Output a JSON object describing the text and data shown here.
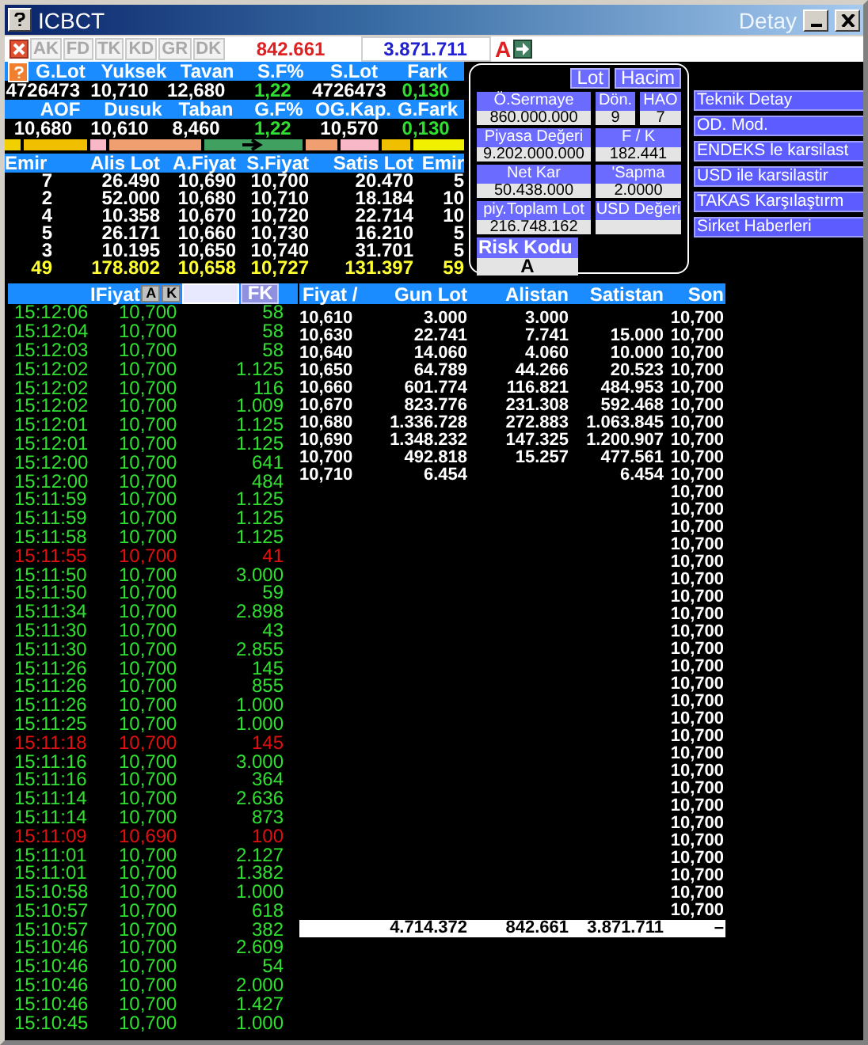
{
  "window": {
    "title": "ICBCT",
    "subtitle": "Detay"
  },
  "toolbar": {
    "tabs": [
      {
        "label": "AK",
        "disabled": true
      },
      {
        "label": "FD",
        "disabled": true
      },
      {
        "label": "TK",
        "disabled": true
      },
      {
        "label": "KD",
        "disabled": true
      },
      {
        "label": "GR",
        "disabled": true
      },
      {
        "label": "DK",
        "disabled": true
      }
    ],
    "alistan_total": "842.661",
    "satistan_total": "3.871.711",
    "mode": "A"
  },
  "stats": [
    {
      "cells": [
        {
          "label": "G.Lot",
          "value": "4726473",
          "up": false
        },
        {
          "label": "Yuksek",
          "value": "10,710",
          "up": false
        },
        {
          "label": "Tavan",
          "value": "12,680",
          "up": false
        },
        {
          "label": "S.F%",
          "value": "1,22",
          "up": true
        },
        {
          "label": "S.Lot",
          "value": "4726473",
          "up": false
        },
        {
          "label": "Fark",
          "value": "0,130",
          "up": true
        }
      ]
    },
    {
      "cells": [
        {
          "label": "AOF",
          "value": "10,680",
          "up": false
        },
        {
          "label": "Dusuk",
          "value": "10,610",
          "up": false
        },
        {
          "label": "Taban",
          "value": "8,460",
          "up": false
        },
        {
          "label": "G.F%",
          "value": "1,22",
          "up": true
        },
        {
          "label": "OG.Kap.",
          "value": "10,570",
          "up": false
        },
        {
          "label": "G.Fark",
          "value": "0,130",
          "up": true
        }
      ]
    }
  ],
  "order_book": {
    "columns": [
      "Emir",
      "Alis Lot",
      "A.Fiyat",
      "S.Fiyat",
      "Satis Lot",
      "Emir"
    ],
    "rows": [
      [
        "7",
        "26.490",
        "10,690",
        "10,700",
        "20.470",
        "5"
      ],
      [
        "2",
        "52.000",
        "10,680",
        "10,710",
        "18.184",
        "10"
      ],
      [
        "4",
        "10.358",
        "10,670",
        "10,720",
        "22.714",
        "10"
      ],
      [
        "5",
        "26.171",
        "10,660",
        "10,730",
        "16.210",
        "5"
      ],
      [
        "3",
        "10.195",
        "10,650",
        "10,740",
        "31.701",
        "5"
      ]
    ],
    "total": [
      "49",
      "178.802",
      "10,658",
      "10,727",
      "131.397",
      "59"
    ]
  },
  "info_panel": {
    "toggles": [
      "Lot",
      "Hacim"
    ],
    "field_rows": [
      [
        {
          "label": "Ö.Sermaye",
          "value": "860.000.000"
        },
        {
          "label": "Dön.",
          "value": "9"
        },
        {
          "label": "HAO",
          "value": "7"
        }
      ],
      [
        {
          "label": "Piyasa Değeri",
          "value": "9.202.000.000"
        },
        {
          "label": "F / K",
          "value": "182.441"
        }
      ],
      [
        {
          "label": "Net Kar",
          "value": "50.438.000"
        },
        {
          "label": "'Sapma",
          "value": "2.0000"
        }
      ],
      [
        {
          "label": "piy.Toplam Lot",
          "value": "216.748.162"
        },
        {
          "label": "USD Değeri"
        }
      ]
    ],
    "risk": {
      "label": "Risk Kodu",
      "value": "A"
    }
  },
  "actions": [
    "Teknik Detay",
    "OD. Mod.",
    "ENDEKS le karsilast",
    "USD ile karsilastir",
    "TAKAS Karşılaştırm",
    "Sirket Haberleri"
  ],
  "trades": {
    "header": "IFiyat",
    "buttons": [
      "A",
      "K"
    ],
    "filter_button": "FK",
    "rows": [
      {
        "time": "15:12:06",
        "price": "10,700",
        "lot": "58",
        "down": false
      },
      {
        "time": "15:12:04",
        "price": "10,700",
        "lot": "58",
        "down": false
      },
      {
        "time": "15:12:03",
        "price": "10,700",
        "lot": "58",
        "down": false
      },
      {
        "time": "15:12:02",
        "price": "10,700",
        "lot": "1.125",
        "down": false
      },
      {
        "time": "15:12:02",
        "price": "10,700",
        "lot": "116",
        "down": false
      },
      {
        "time": "15:12:02",
        "price": "10,700",
        "lot": "1.009",
        "down": false
      },
      {
        "time": "15:12:01",
        "price": "10,700",
        "lot": "1.125",
        "down": false
      },
      {
        "time": "15:12:01",
        "price": "10,700",
        "lot": "1.125",
        "down": false
      },
      {
        "time": "15:12:00",
        "price": "10,700",
        "lot": "641",
        "down": false
      },
      {
        "time": "15:12:00",
        "price": "10,700",
        "lot": "484",
        "down": false
      },
      {
        "time": "15:11:59",
        "price": "10,700",
        "lot": "1.125",
        "down": false
      },
      {
        "time": "15:11:59",
        "price": "10,700",
        "lot": "1.125",
        "down": false
      },
      {
        "time": "15:11:58",
        "price": "10,700",
        "lot": "1.125",
        "down": false
      },
      {
        "time": "15:11:55",
        "price": "10,700",
        "lot": "41",
        "down": true
      },
      {
        "time": "15:11:50",
        "price": "10,700",
        "lot": "3.000",
        "down": false
      },
      {
        "time": "15:11:50",
        "price": "10,700",
        "lot": "59",
        "down": false
      },
      {
        "time": "15:11:34",
        "price": "10,700",
        "lot": "2.898",
        "down": false
      },
      {
        "time": "15:11:30",
        "price": "10,700",
        "lot": "43",
        "down": false
      },
      {
        "time": "15:11:30",
        "price": "10,700",
        "lot": "2.855",
        "down": false
      },
      {
        "time": "15:11:26",
        "price": "10,700",
        "lot": "145",
        "down": false
      },
      {
        "time": "15:11:26",
        "price": "10,700",
        "lot": "855",
        "down": false
      },
      {
        "time": "15:11:26",
        "price": "10,700",
        "lot": "1.000",
        "down": false
      },
      {
        "time": "15:11:25",
        "price": "10,700",
        "lot": "1.000",
        "down": false
      },
      {
        "time": "15:11:18",
        "price": "10,700",
        "lot": "145",
        "down": true
      },
      {
        "time": "15:11:16",
        "price": "10,700",
        "lot": "3.000",
        "down": false
      },
      {
        "time": "15:11:16",
        "price": "10,700",
        "lot": "364",
        "down": false
      },
      {
        "time": "15:11:14",
        "price": "10,700",
        "lot": "2.636",
        "down": false
      },
      {
        "time": "15:11:14",
        "price": "10,700",
        "lot": "873",
        "down": false
      },
      {
        "time": "15:11:09",
        "price": "10,690",
        "lot": "100",
        "down": true
      },
      {
        "time": "15:11:01",
        "price": "10,700",
        "lot": "2.127",
        "down": false
      },
      {
        "time": "15:11:01",
        "price": "10,700",
        "lot": "1.382",
        "down": false
      },
      {
        "time": "15:10:58",
        "price": "10,700",
        "lot": "1.000",
        "down": false
      },
      {
        "time": "15:10:57",
        "price": "10,700",
        "lot": "618",
        "down": false
      },
      {
        "time": "15:10:57",
        "price": "10,700",
        "lot": "382",
        "down": false
      },
      {
        "time": "15:10:46",
        "price": "10,700",
        "lot": "2.609",
        "down": false
      },
      {
        "time": "15:10:46",
        "price": "10,700",
        "lot": "54",
        "down": false
      },
      {
        "time": "15:10:46",
        "price": "10,700",
        "lot": "2.000",
        "down": false
      },
      {
        "time": "15:10:46",
        "price": "10,700",
        "lot": "1.427",
        "down": false
      },
      {
        "time": "15:10:45",
        "price": "10,700",
        "lot": "1.000",
        "down": false
      }
    ]
  },
  "depth": {
    "columns": [
      "Fiyat /",
      "Gun Lot",
      "Alistan",
      "Satistan",
      "Son"
    ],
    "rows": [
      {
        "price": "10,610",
        "gun_lot": "3.000",
        "alistan": "3.000",
        "son": "10,700"
      },
      {
        "price": "10,630",
        "gun_lot": "22.741",
        "alistan": "7.741",
        "satistan": "15.000",
        "son": "10,700"
      },
      {
        "price": "10,640",
        "gun_lot": "14.060",
        "alistan": "4.060",
        "satistan": "10.000",
        "son": "10,700"
      },
      {
        "price": "10,650",
        "gun_lot": "64.789",
        "alistan": "44.266",
        "satistan": "20.523",
        "son": "10,700"
      },
      {
        "price": "10,660",
        "gun_lot": "601.774",
        "alistan": "116.821",
        "satistan": "484.953",
        "son": "10,700"
      },
      {
        "price": "10,670",
        "gun_lot": "823.776",
        "alistan": "231.308",
        "satistan": "592.468",
        "son": "10,700"
      },
      {
        "price": "10,680",
        "gun_lot": "1.336.728",
        "alistan": "272.883",
        "satistan": "1.063.845",
        "son": "10,700"
      },
      {
        "price": "10,690",
        "gun_lot": "1.348.232",
        "alistan": "147.325",
        "satistan": "1.200.907",
        "son": "10,700"
      },
      {
        "price": "10,700",
        "gun_lot": "492.818",
        "alistan": "15.257",
        "satistan": "477.561",
        "son": "10,700"
      },
      {
        "price": "10,710",
        "gun_lot": "6.454",
        "satistan": "6.454",
        "son": "10,700"
      },
      {
        "son": "10,700"
      },
      {
        "son": "10,700"
      },
      {
        "son": "10,700"
      },
      {
        "son": "10,700"
      },
      {
        "son": "10,700"
      },
      {
        "son": "10,700"
      },
      {
        "son": "10,700"
      },
      {
        "son": "10,700"
      },
      {
        "son": "10,700"
      },
      {
        "son": "10,700"
      },
      {
        "son": "10,700"
      },
      {
        "son": "10,700"
      },
      {
        "son": "10,700"
      },
      {
        "son": "10,700"
      },
      {
        "son": "10,700"
      },
      {
        "son": "10,700"
      },
      {
        "son": "10,700"
      },
      {
        "son": "10,700"
      },
      {
        "son": "10,700"
      },
      {
        "son": "10,700"
      },
      {
        "son": "10,700"
      },
      {
        "son": "10,700"
      },
      {
        "son": "10,700"
      },
      {
        "son": "10,700"
      },
      {
        "son": "10,700"
      }
    ],
    "total": {
      "gun_lot": "4.714.372",
      "alistan": "842.661",
      "satistan": "3.871.711",
      "son": "–"
    }
  }
}
